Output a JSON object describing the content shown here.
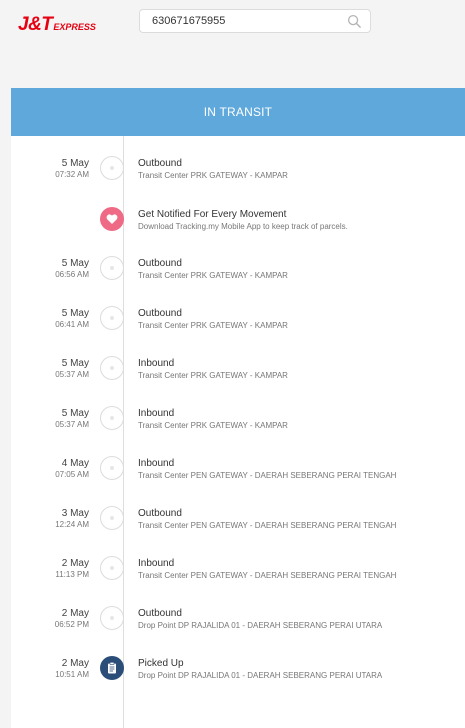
{
  "brand": {
    "main": "J&T",
    "sub": "EXPRESS"
  },
  "search": {
    "value": "630671675955"
  },
  "status": "IN TRANSIT",
  "colors": {
    "brand_red": "#e60012",
    "status_blue": "#5fa8dc",
    "notify_pink": "#ef6a84",
    "picked_navy": "#2a4e78"
  },
  "events": [
    {
      "date": "5 May",
      "time": "07:32 AM",
      "title": "Outbound",
      "location": "Transit Center PRK GATEWAY - KAMPAR",
      "icon": "circle-dot-icon"
    },
    {
      "date": "",
      "time": "",
      "title": "Get Notified For Every Movement",
      "location": "Download Tracking.my Mobile App to keep track of parcels.",
      "icon": "heart-icon"
    },
    {
      "date": "5 May",
      "time": "06:56 AM",
      "title": "Outbound",
      "location": "Transit Center PRK GATEWAY - KAMPAR",
      "icon": "circle-dot-icon"
    },
    {
      "date": "5 May",
      "time": "06:41 AM",
      "title": "Outbound",
      "location": "Transit Center PRK GATEWAY - KAMPAR",
      "icon": "circle-dot-icon"
    },
    {
      "date": "5 May",
      "time": "05:37 AM",
      "title": "Inbound",
      "location": "Transit Center PRK GATEWAY - KAMPAR",
      "icon": "circle-dot-icon"
    },
    {
      "date": "5 May",
      "time": "05:37 AM",
      "title": "Inbound",
      "location": "Transit Center PRK GATEWAY - KAMPAR",
      "icon": "circle-dot-icon"
    },
    {
      "date": "4 May",
      "time": "07:05 AM",
      "title": "Inbound",
      "location": "Transit Center PEN GATEWAY - DAERAH SEBERANG PERAI TENGAH",
      "icon": "circle-dot-icon"
    },
    {
      "date": "3 May",
      "time": "12:24 AM",
      "title": "Outbound",
      "location": "Transit Center PEN GATEWAY - DAERAH SEBERANG PERAI TENGAH",
      "icon": "circle-dot-icon"
    },
    {
      "date": "2 May",
      "time": "11:13 PM",
      "title": "Inbound",
      "location": "Transit Center PEN GATEWAY - DAERAH SEBERANG PERAI TENGAH",
      "icon": "circle-dot-icon"
    },
    {
      "date": "2 May",
      "time": "06:52 PM",
      "title": "Outbound",
      "location": "Drop Point DP RAJALIDA 01 - DAERAH SEBERANG PERAI UTARA",
      "icon": "circle-dot-icon"
    },
    {
      "date": "2 May",
      "time": "10:51 AM",
      "title": "Picked Up",
      "location": "Drop Point DP RAJALIDA 01 - DAERAH SEBERANG PERAI UTARA",
      "icon": "clipboard-icon"
    }
  ]
}
